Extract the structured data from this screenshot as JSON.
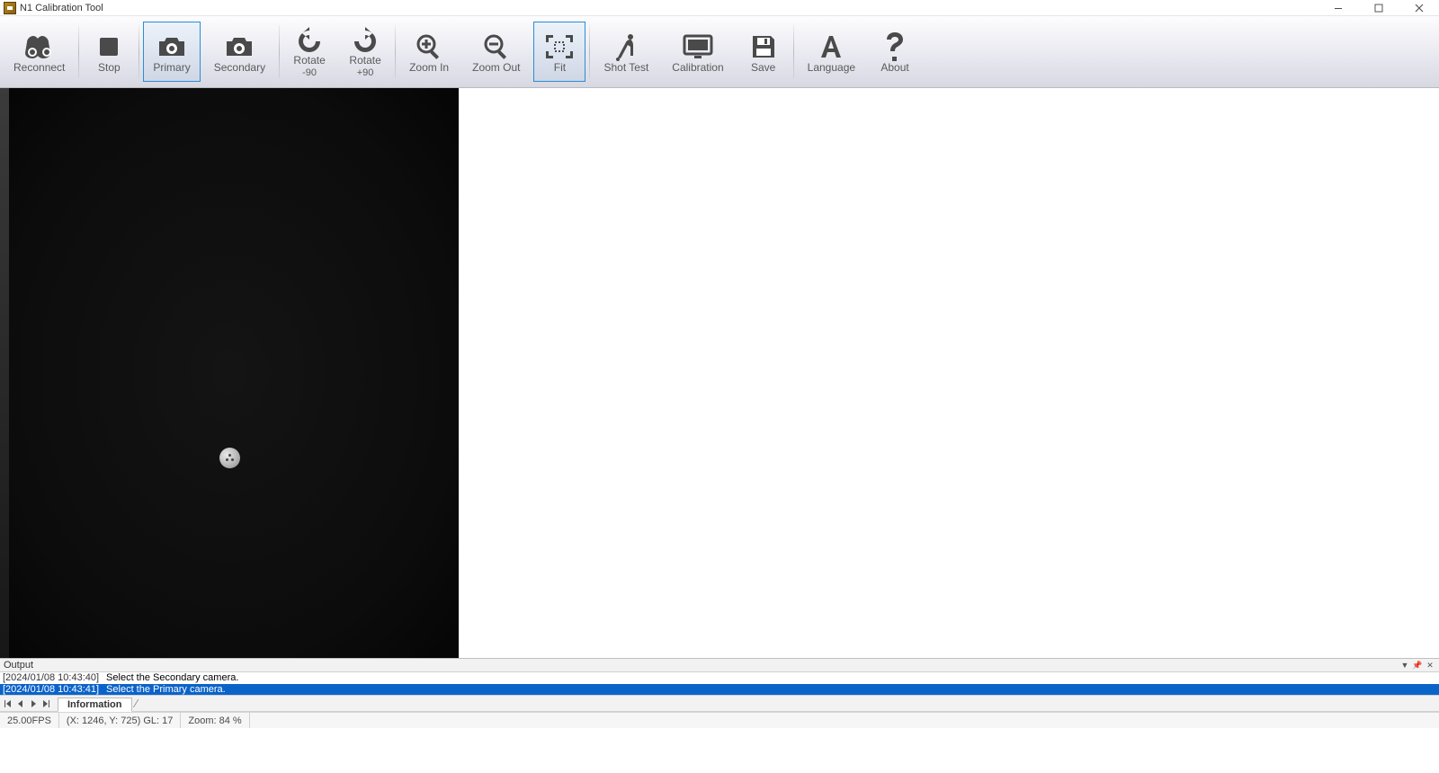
{
  "window": {
    "title": "N1 Calibration Tool"
  },
  "toolbar": {
    "reconnect": "Reconnect",
    "stop": "Stop",
    "primary": "Primary",
    "secondary": "Secondary",
    "rotate_neg": "Rotate",
    "rotate_neg_sub": "-90",
    "rotate_pos": "Rotate",
    "rotate_pos_sub": "+90",
    "zoom_in": "Zoom In",
    "zoom_out": "Zoom Out",
    "fit": "Fit",
    "shot_test": "Shot Test",
    "calibration": "Calibration",
    "save": "Save",
    "language": "Language",
    "about": "About"
  },
  "output": {
    "panel_title": "Output",
    "rows": [
      {
        "ts": "[2024/01/08 10:43:40]",
        "msg": "Select the Secondary camera."
      },
      {
        "ts": "[2024/01/08 10:43:41]",
        "msg": "Select the Primary camera."
      }
    ],
    "info_tab": "Information"
  },
  "status": {
    "fps": "25.00FPS",
    "coords": "(X: 1246, Y: 725) GL: 17",
    "zoom": "Zoom: 84 %"
  }
}
